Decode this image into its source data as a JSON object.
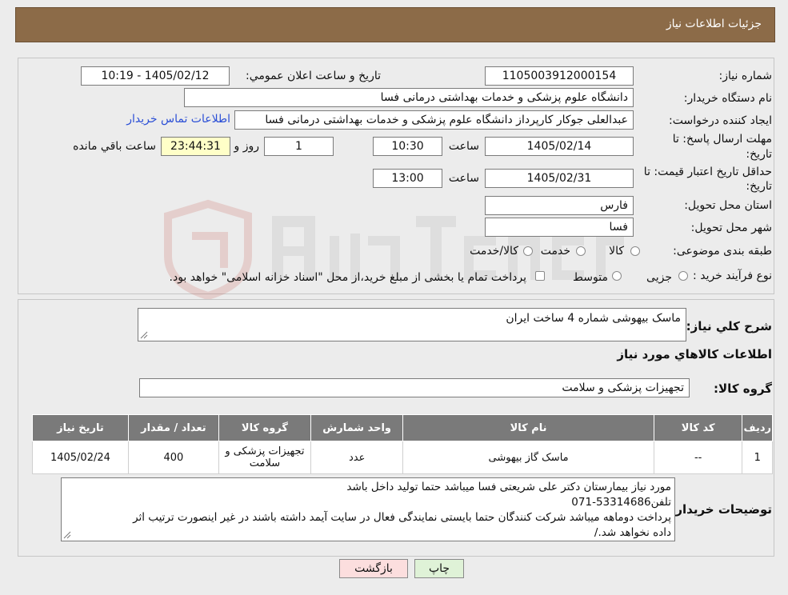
{
  "header": {
    "title": "جزئیات اطلاعات نیاز"
  },
  "form": {
    "need_number_label": "شماره نیاز:",
    "need_number": "1105003912000154",
    "announce_label": "تاريخ و ساعت اعلان عمومي:",
    "announce_value": "1405/02/12 - 10:19",
    "buyer_org_label": "نام دستگاه خريدار:",
    "buyer_org": "دانشگاه علوم پزشکی و خدمات بهداشتی درمانی فسا",
    "requester_label": "ايجاد کننده درخواست:",
    "requester": "عبدالعلی جوکار کارپرداز دانشگاه علوم پزشکی و خدمات بهداشتی درمانی فسا",
    "contact_link": "اطلاعات تماس خريدار",
    "deadline_label_1": "مهلت ارسال پاسخ: تا",
    "deadline_label_2": "تاريخ:",
    "deadline_date": "1405/02/14",
    "time_label": "ساعت",
    "deadline_time": "10:30",
    "days": "1",
    "days_label": "روز و",
    "remaining": "23:44:31",
    "remaining_label": "ساعت باقي مانده",
    "validity_label_1": "حداقل تاريخ اعتبار قيمت: تا",
    "validity_label_2": "تاريخ:",
    "validity_date": "1405/02/31",
    "validity_time": "13:00",
    "province_label": "استان محل تحويل:",
    "province": "فارس",
    "city_label": "شهر محل تحويل:",
    "city": "فسا",
    "category_label": "طبقه بندی موضوعی:",
    "category_options": [
      "کالا",
      "خدمت",
      "کالا/خدمت"
    ],
    "process_label": "نوع فرآيند خريد :",
    "process_options": [
      "جزیی",
      "متوسط"
    ],
    "process_note": "پرداخت تمام يا بخشی از مبلغ خريد،از محل \"اسناد خزانه اسلامی\" خواهد بود."
  },
  "summary": {
    "desc_label": "شرح کلي نياز:",
    "desc": "ماسک بیهوشی شماره 4 ساخت ایران",
    "items_title": "اطلاعات کالاهاي مورد نياز",
    "group_label": "گروه کالا:",
    "group": "تجهیزات پزشکی و سلامت"
  },
  "table": {
    "headers": [
      "رديف",
      "کد کالا",
      "نام کالا",
      "واحد شمارش",
      "گروه کالا",
      "تعداد / مقدار",
      "تاريخ نياز"
    ],
    "rows": [
      [
        "1",
        "--",
        "ماسک گاز بیهوشی",
        "عدد",
        "تجهیزات پزشکی و سلامت",
        "400",
        "1405/02/24"
      ]
    ]
  },
  "buyer_notes": {
    "label": "توضيحات خريدار:",
    "lines": [
      "مورد نیاز بیمارستان دکتر علی شریعتی فسا میباشد حتما تولید داخل باشد",
      "تلفن53314686-071",
      "پرداخت دوماهه میباشد شرکت کنندگان حتما بایستی نمایندگی فعال در سایت آیمد داشته باشند در غیر اینصورت ترتیب اثر",
      "داده نخواهد شد./"
    ]
  },
  "buttons": {
    "print": "چاپ",
    "back": "بازگشت"
  },
  "colors": {
    "header": "#8c6b48",
    "back_button": "#fcdede",
    "print_button": "#dff2d7",
    "remaining_box": "#ffffc8"
  }
}
